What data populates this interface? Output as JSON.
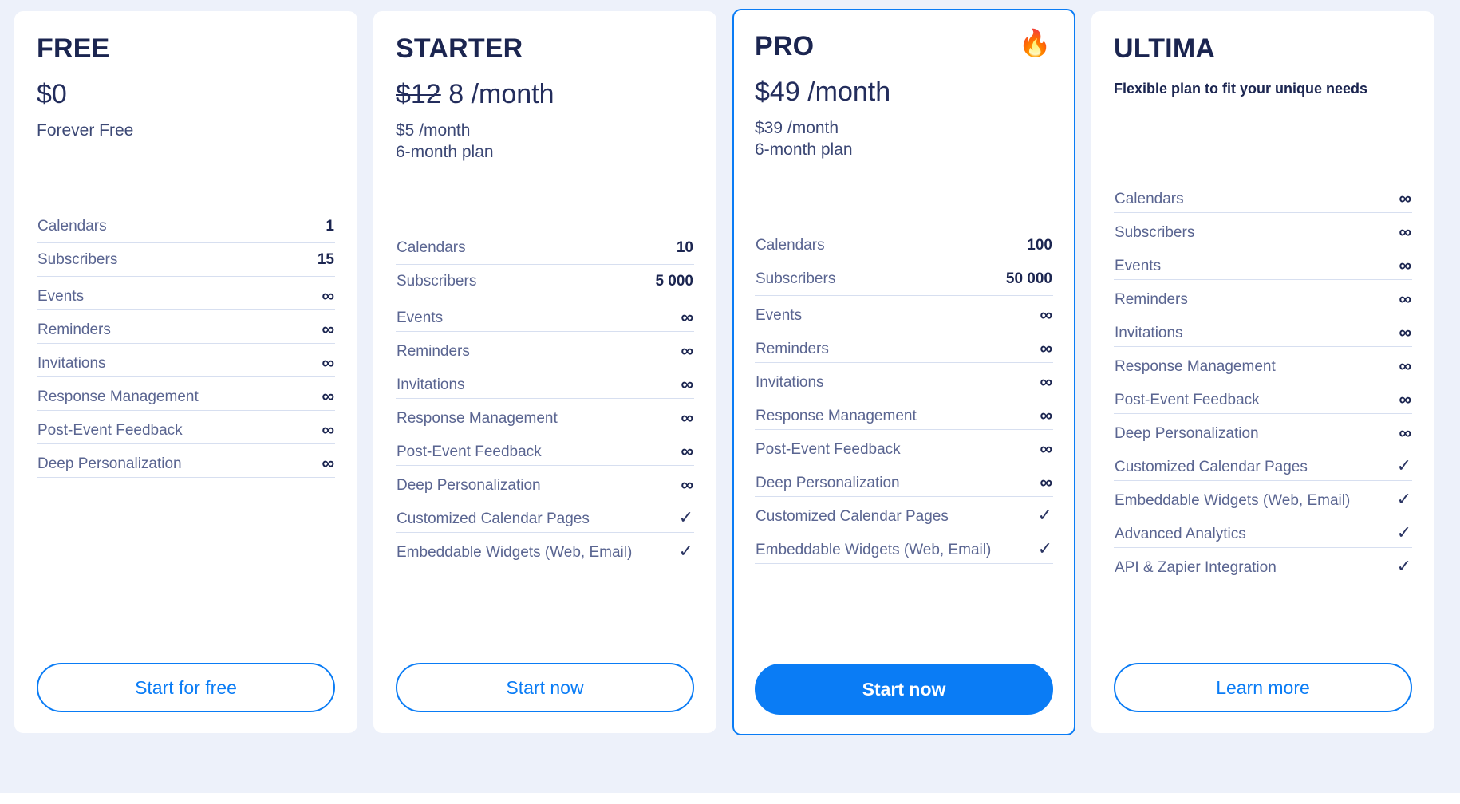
{
  "theme": {
    "background": "#edf1fa",
    "card_background": "#ffffff",
    "accent": "#0a7cf5",
    "heading_color": "#1b2550",
    "label_color": "#5a6591",
    "divider_color": "#d7dff0"
  },
  "symbols": {
    "infinity": "∞",
    "check": "✓",
    "flame": "🔥"
  },
  "plans": [
    {
      "id": "free",
      "name": "FREE",
      "price_old": "",
      "price_main": "$0",
      "price_unit": "",
      "price_sub": "Forever Free",
      "tagline": "",
      "badge_icon": "",
      "featured": false,
      "cta_label": "Start for free",
      "cta_style": "outline",
      "features": [
        {
          "label": "Calendars",
          "value": "1",
          "kind": "number"
        },
        {
          "label": "Subscribers",
          "value": "15",
          "kind": "number"
        },
        {
          "label": "Events",
          "value": "∞",
          "kind": "infinity"
        },
        {
          "label": "Reminders",
          "value": "∞",
          "kind": "infinity"
        },
        {
          "label": "Invitations",
          "value": "∞",
          "kind": "infinity"
        },
        {
          "label": "Response Management",
          "value": "∞",
          "kind": "infinity"
        },
        {
          "label": "Post-Event Feedback",
          "value": "∞",
          "kind": "infinity"
        },
        {
          "label": "Deep Personalization",
          "value": "∞",
          "kind": "infinity"
        }
      ]
    },
    {
      "id": "starter",
      "name": "STARTER",
      "price_old": "$12",
      "price_main": "8",
      "price_unit": "/month",
      "price_sub": "$5 /month\n6-month plan",
      "tagline": "",
      "badge_icon": "",
      "featured": false,
      "cta_label": "Start now",
      "cta_style": "outline",
      "features": [
        {
          "label": "Calendars",
          "value": "10",
          "kind": "number"
        },
        {
          "label": "Subscribers",
          "value": "5 000",
          "kind": "number"
        },
        {
          "label": "Events",
          "value": "∞",
          "kind": "infinity"
        },
        {
          "label": "Reminders",
          "value": "∞",
          "kind": "infinity"
        },
        {
          "label": "Invitations",
          "value": "∞",
          "kind": "infinity"
        },
        {
          "label": "Response Management",
          "value": "∞",
          "kind": "infinity"
        },
        {
          "label": "Post-Event Feedback",
          "value": "∞",
          "kind": "infinity"
        },
        {
          "label": "Deep Personalization",
          "value": "∞",
          "kind": "infinity"
        },
        {
          "label": "Customized Calendar Pages",
          "value": "✓",
          "kind": "check"
        },
        {
          "label": "Embeddable Widgets (Web, Email)",
          "value": "✓",
          "kind": "check"
        }
      ]
    },
    {
      "id": "pro",
      "name": "PRO",
      "price_old": "",
      "price_main": "$49",
      "price_unit": "/month",
      "price_sub": "$39 /month\n6-month plan",
      "tagline": "",
      "badge_icon": "🔥",
      "featured": true,
      "cta_label": "Start now",
      "cta_style": "solid",
      "features": [
        {
          "label": "Calendars",
          "value": "100",
          "kind": "number"
        },
        {
          "label": "Subscribers",
          "value": "50 000",
          "kind": "number"
        },
        {
          "label": "Events",
          "value": "∞",
          "kind": "infinity"
        },
        {
          "label": "Reminders",
          "value": "∞",
          "kind": "infinity"
        },
        {
          "label": "Invitations",
          "value": "∞",
          "kind": "infinity"
        },
        {
          "label": "Response Management",
          "value": "∞",
          "kind": "infinity"
        },
        {
          "label": "Post-Event Feedback",
          "value": "∞",
          "kind": "infinity"
        },
        {
          "label": "Deep Personalization",
          "value": "∞",
          "kind": "infinity"
        },
        {
          "label": "Customized Calendar Pages",
          "value": "✓",
          "kind": "check"
        },
        {
          "label": "Embeddable Widgets (Web, Email)",
          "value": "✓",
          "kind": "check"
        }
      ]
    },
    {
      "id": "ultima",
      "name": "ULTIMA",
      "price_old": "",
      "price_main": "",
      "price_unit": "",
      "price_sub": "",
      "tagline": "Flexible plan to fit your unique needs",
      "badge_icon": "",
      "featured": false,
      "cta_label": "Learn more",
      "cta_style": "outline",
      "features": [
        {
          "label": "Calendars",
          "value": "∞",
          "kind": "infinity"
        },
        {
          "label": "Subscribers",
          "value": "∞",
          "kind": "infinity"
        },
        {
          "label": "Events",
          "value": "∞",
          "kind": "infinity"
        },
        {
          "label": "Reminders",
          "value": "∞",
          "kind": "infinity"
        },
        {
          "label": "Invitations",
          "value": "∞",
          "kind": "infinity"
        },
        {
          "label": "Response Management",
          "value": "∞",
          "kind": "infinity"
        },
        {
          "label": "Post-Event Feedback",
          "value": "∞",
          "kind": "infinity"
        },
        {
          "label": "Deep Personalization",
          "value": "∞",
          "kind": "infinity"
        },
        {
          "label": "Customized Calendar Pages",
          "value": "✓",
          "kind": "check"
        },
        {
          "label": "Embeddable Widgets (Web, Email)",
          "value": "✓",
          "kind": "check"
        },
        {
          "label": "Advanced Analytics",
          "value": "✓",
          "kind": "check"
        },
        {
          "label": "API & Zapier Integration",
          "value": "✓",
          "kind": "check"
        }
      ]
    }
  ]
}
